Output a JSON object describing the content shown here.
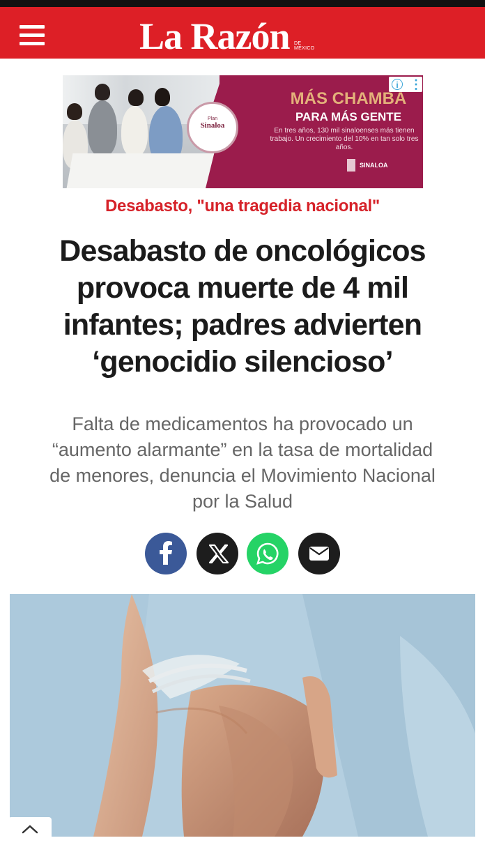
{
  "header": {
    "brand": "La Razón",
    "brand_tag": "DE MÉXICO",
    "menu_icon": "hamburger-menu-icon"
  },
  "ad": {
    "seal_line1": "Plan",
    "seal_line2": "Sinaloa",
    "headline1": "MÁS CHAMBA",
    "headline2": "PARA MÁS GENTE",
    "body": "En tres años, 130 mil sinaloenses más tienen trabajo. Un crecimiento del 10% en tan solo tres años.",
    "footer": "SINALOA",
    "info_icon": "info-icon",
    "more_icon": "more-vertical-icon"
  },
  "article": {
    "kicker": "Desabasto, \"una tragedia nacional\"",
    "headline_lines": [
      "Desabasto de oncológicos",
      "provoca muerte de 4 mil",
      "infantes; padres advierten",
      "‘genocidio silencioso’"
    ],
    "subhead_lines": [
      "Falta de medicamentos ha provocado un",
      "“aumento alarmante” en la tasa de mortalidad",
      "de menores, denuncia el Movimiento Nacional",
      "por la Salud"
    ]
  },
  "share": [
    {
      "name": "facebook-icon",
      "color": "#3b5998"
    },
    {
      "name": "x-icon",
      "color": "#1d1d1d"
    },
    {
      "name": "whatsapp-icon",
      "color": "#25d366"
    },
    {
      "name": "email-icon",
      "color": "#1d1d1d"
    }
  ],
  "colors": {
    "brand_red": "#dd1f26",
    "kicker_red": "#d62229",
    "ad_magenta": "#9b1c4c"
  },
  "scroll_top_icon": "chevron-up-icon"
}
